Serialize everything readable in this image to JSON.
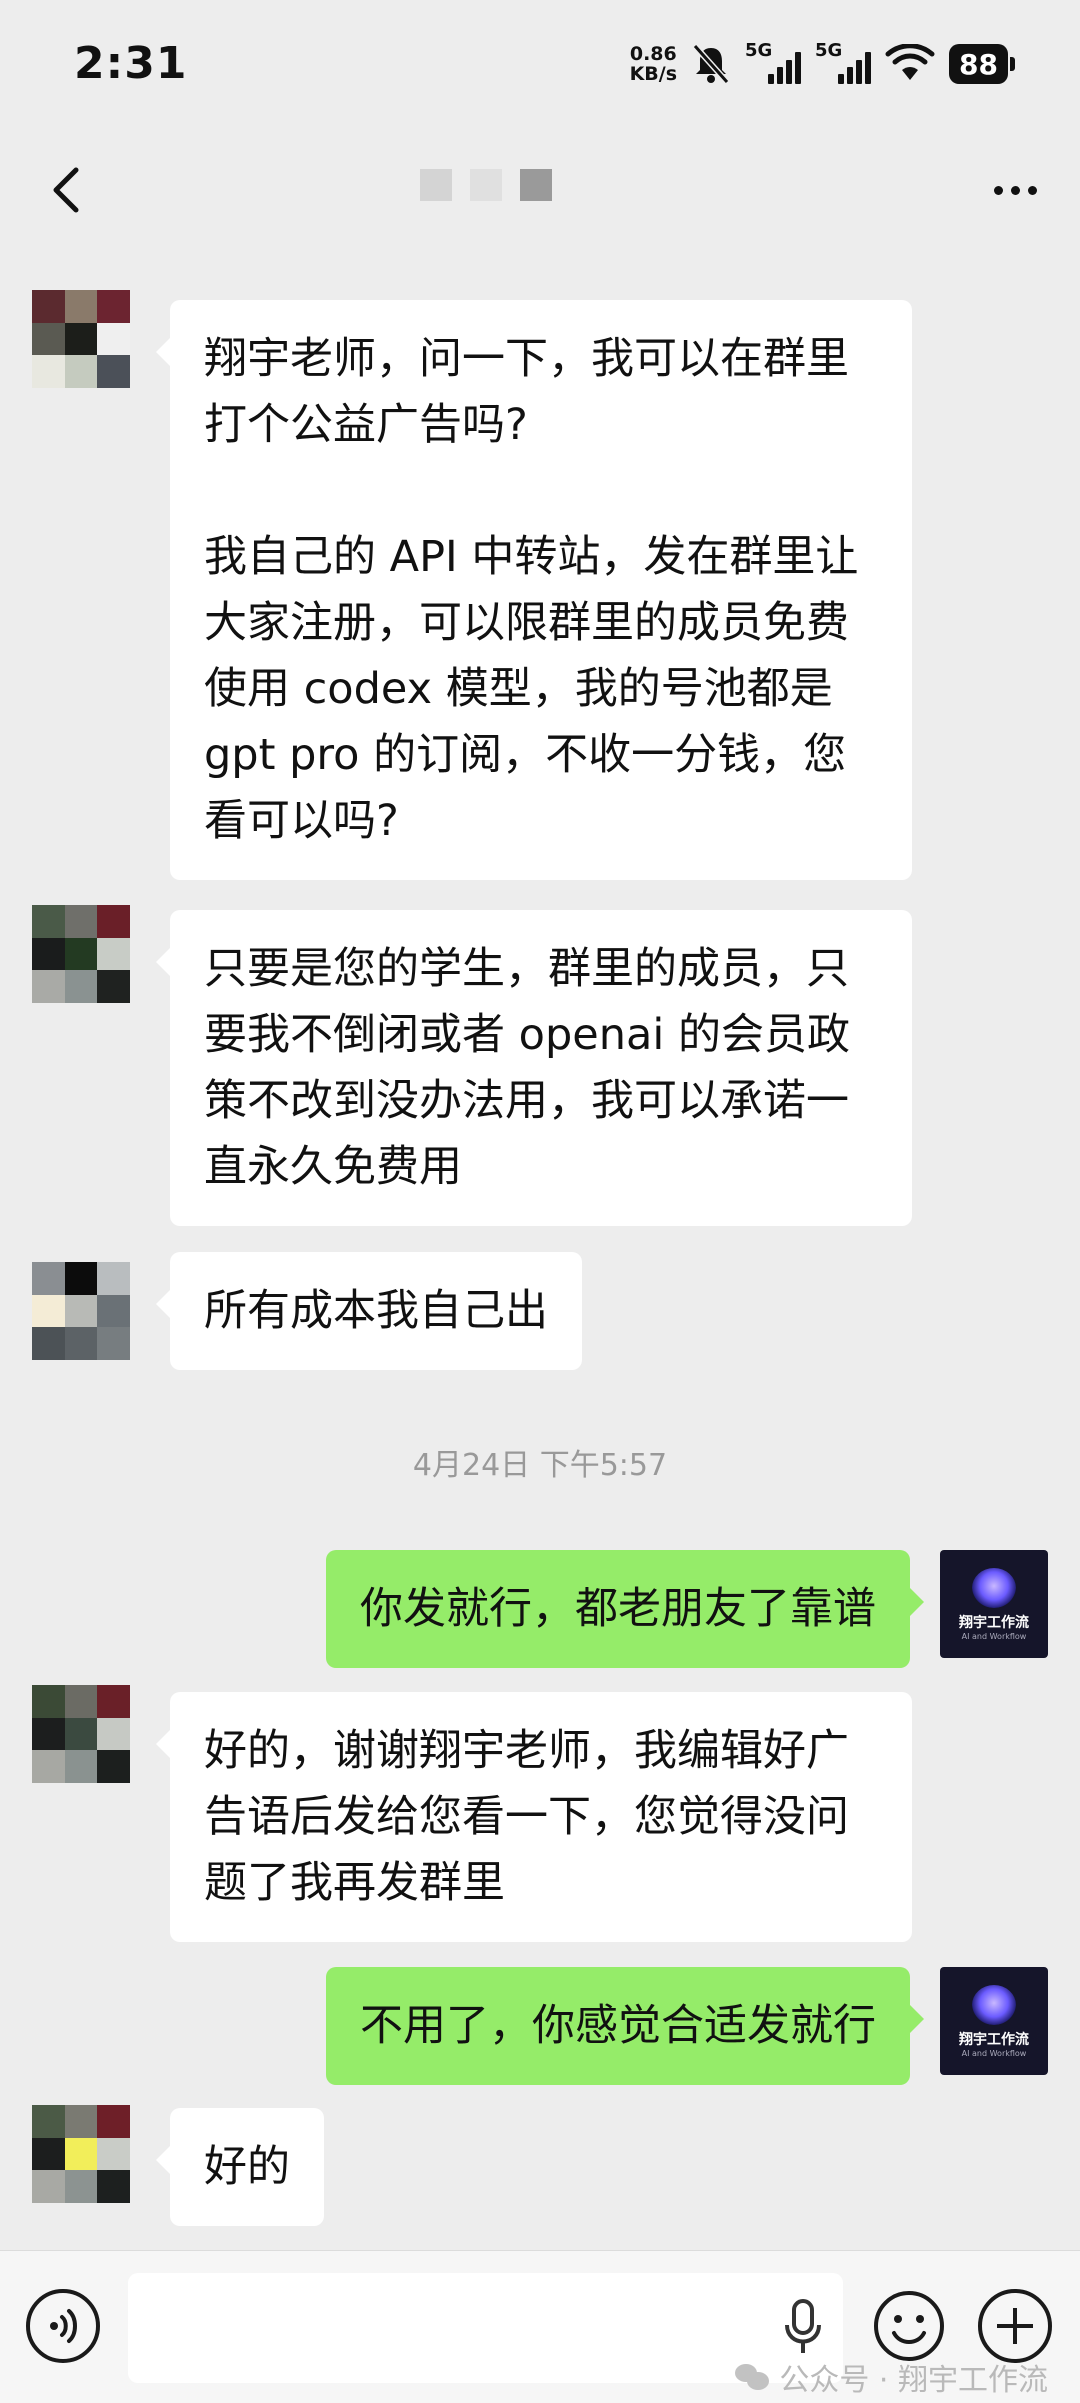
{
  "status_bar": {
    "time": "2:31",
    "net_speed_value": "0.86",
    "net_speed_unit": "KB/s",
    "sim1_label": "5G",
    "sim2_label": "5G",
    "battery_level": "88"
  },
  "header": {
    "title_obscured": true
  },
  "messages": [
    {
      "side": "left",
      "lines": [
        "翔宇老师，问一下，我可以在群里",
        "打个公益广告吗?",
        "",
        "我自己的 API 中转站，发在群里让",
        "大家注册，可以限群里的成员免费",
        "使用 codex 模型，我的号池都是",
        "gpt pro 的订阅，不收一分钱，您",
        "看可以吗?"
      ]
    },
    {
      "side": "left",
      "lines": [
        "只要是您的学生，群里的成员，只",
        "要我不倒闭或者 openai 的会员政",
        "策不改到没办法用，我可以承诺一",
        "直永久免费用"
      ]
    },
    {
      "side": "left",
      "lines": [
        "所有成本我自己出"
      ]
    },
    {
      "side": "right",
      "lines": [
        "你发就行，都老朋友了靠谱"
      ]
    },
    {
      "side": "left",
      "lines": [
        "好的，谢谢翔宇老师，我编辑好广",
        "告语后发给您看一下，您觉得没问",
        "题了我再发群里"
      ]
    },
    {
      "side": "right",
      "lines": [
        "不用了，你感觉合适发就行"
      ]
    },
    {
      "side": "left",
      "lines": [
        "好的"
      ]
    }
  ],
  "timestamp": "4月24日 下午5:57",
  "self_avatar": {
    "title": "翔宇工作流",
    "subtitle": "AI and Workflow"
  },
  "watermark": "公众号 · 翔宇工作流",
  "icons": [
    "back-arrow-icon",
    "more-icon",
    "voice-icon",
    "mic-icon",
    "emoji-icon",
    "plus-icon",
    "wechat-icon"
  ],
  "colors": {
    "background": "#ededed",
    "bubble_left": "#ffffff",
    "bubble_right": "#95ec69",
    "timestamp": "#999999"
  }
}
